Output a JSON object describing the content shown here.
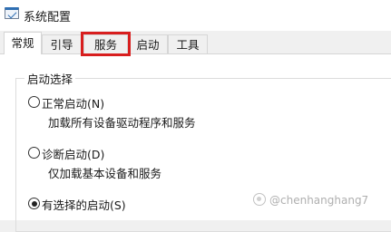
{
  "window": {
    "title": "系统配置",
    "icon": "msconfig-icon"
  },
  "tabs": [
    {
      "label": "常规",
      "active": true
    },
    {
      "label": "引导",
      "active": false
    },
    {
      "label": "服务",
      "active": false,
      "highlighted": true,
      "highlight_color": "#d81e1e"
    },
    {
      "label": "启动",
      "active": false
    },
    {
      "label": "工具",
      "active": false
    }
  ],
  "startup_group": {
    "label": "启动选择",
    "options": [
      {
        "label": "正常启动(N)",
        "description": "加载所有设备驱动程序和服务",
        "selected": false
      },
      {
        "label": "诊断启动(D)",
        "description": "仅加载基本设备和服务",
        "selected": false
      },
      {
        "label": "有选择的启动(S)",
        "selected": true
      }
    ]
  },
  "watermark": {
    "text": "@chenhanghang7"
  }
}
